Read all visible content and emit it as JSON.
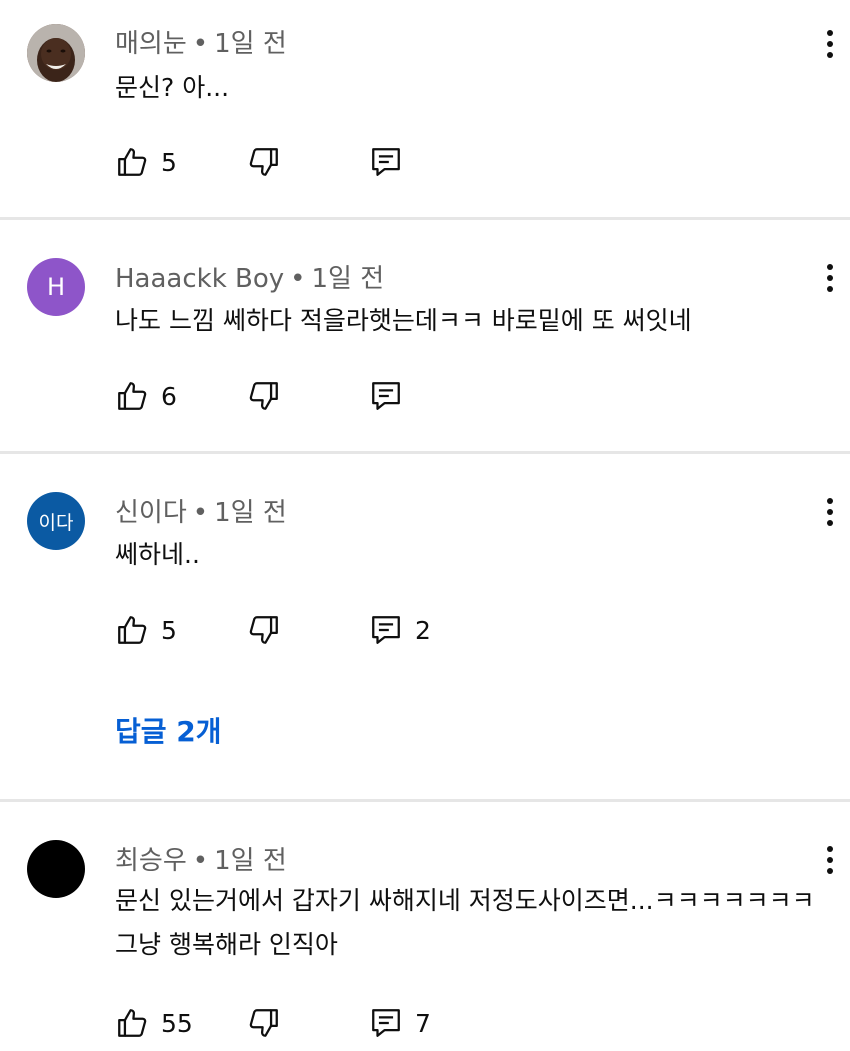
{
  "comments": [
    {
      "author": "매의눈",
      "time": "1일 전",
      "lines": [
        "문신? 아..."
      ],
      "likes": "5",
      "replies": "",
      "avatar": {
        "type": "photo",
        "letter": "",
        "bg": "#6b4a3a"
      }
    },
    {
      "author": "Haaackk Boy",
      "time": "1일 전",
      "lines": [
        "나도 느낌 쎄하다 적을라햇는데ㅋㅋ  바로밑에 또 써잇네"
      ],
      "likes": "6",
      "replies": "",
      "avatar": {
        "type": "letter",
        "letter": "H",
        "bg": "#8e55c9"
      }
    },
    {
      "author": "신이다",
      "time": "1일 전",
      "lines": [
        "쎄하네.."
      ],
      "likes": "5",
      "replies": "2",
      "replies_link": "답글 2개",
      "avatar": {
        "type": "letter",
        "letter": "이다",
        "bg": "#0b5aa3"
      }
    },
    {
      "author": "최승우",
      "time": "1일 전",
      "lines": [
        "문신 있는거에서 갑자기 싸해지네 저정도사이즈면...ㅋㅋㅋㅋㅋㅋㅋ",
        "그냥 행복해라 인직아"
      ],
      "likes": "55",
      "replies": "7",
      "avatar": {
        "type": "solid",
        "letter": "",
        "bg": "#000000"
      }
    }
  ],
  "meta_separator": "•",
  "icons": {
    "like": "thumbs-up-icon",
    "dislike": "thumbs-down-icon",
    "reply": "reply-icon",
    "more": "more-vert-icon"
  },
  "colors": {
    "link": "#065fd4",
    "meta": "#606060",
    "divider": "#e6e6e6"
  }
}
